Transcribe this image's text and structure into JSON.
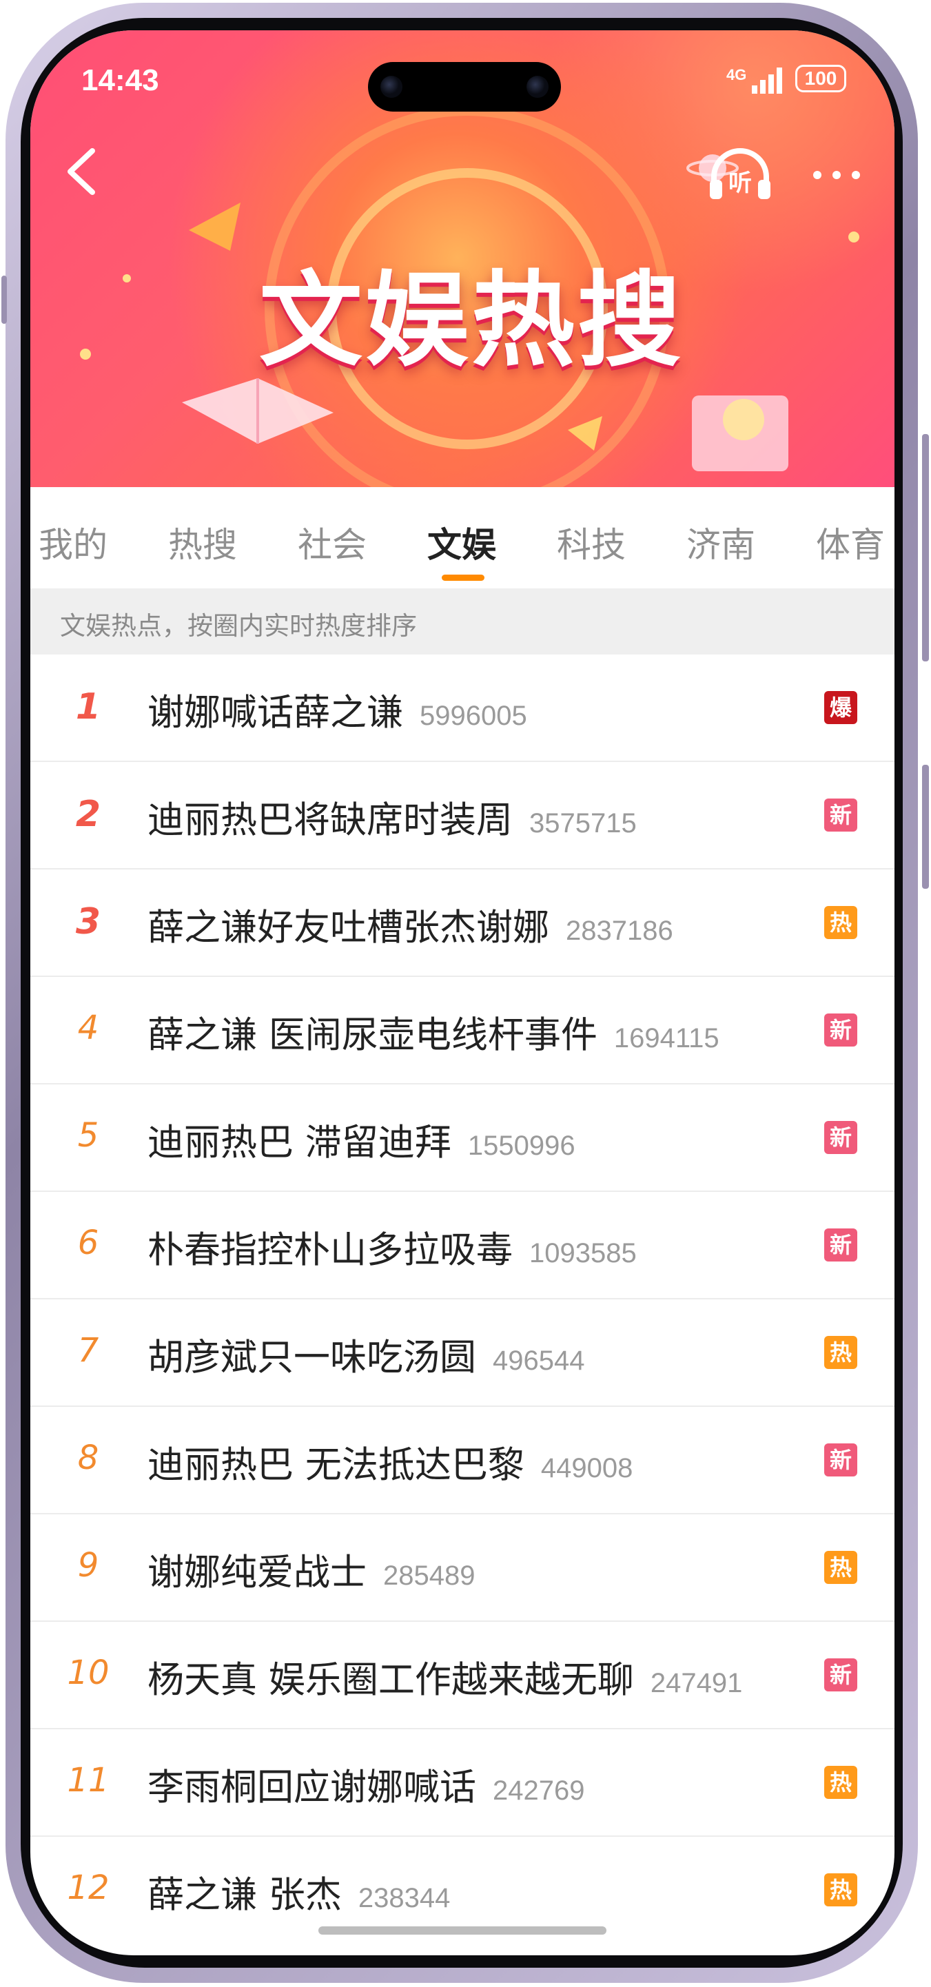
{
  "status_bar": {
    "time": "14:43",
    "network": "4G",
    "battery": "100"
  },
  "banner": {
    "title": "文娱热搜"
  },
  "tabs": [
    {
      "label": "我的",
      "active": false
    },
    {
      "label": "热搜",
      "active": false
    },
    {
      "label": "社会",
      "active": false
    },
    {
      "label": "文娱",
      "active": true
    },
    {
      "label": "科技",
      "active": false
    },
    {
      "label": "济南",
      "active": false
    },
    {
      "label": "体育",
      "active": false
    }
  ],
  "subheader": "文娱热点，按圈内实时热度排序",
  "colors": {
    "accent": "#ff8a00",
    "badge_bao": "#c8161d",
    "badge_xin": "#f05a7a",
    "badge_re": "#ff9a1a",
    "rank_top": "#f1584a",
    "rank_other": "#f28a2e"
  },
  "items": [
    {
      "rank": "1",
      "title": "谢娜喊话薛之谦",
      "count": "5996005",
      "badge": "爆"
    },
    {
      "rank": "2",
      "title": "迪丽热巴将缺席时装周",
      "count": "3575715",
      "badge": "新"
    },
    {
      "rank": "3",
      "title": "薛之谦好友吐槽张杰谢娜",
      "count": "2837186",
      "badge": "热"
    },
    {
      "rank": "4",
      "title": "薛之谦 医闹尿壶电线杆事件",
      "count": "1694115",
      "badge": "新"
    },
    {
      "rank": "5",
      "title": "迪丽热巴 滞留迪拜",
      "count": "1550996",
      "badge": "新"
    },
    {
      "rank": "6",
      "title": "朴春指控朴山多拉吸毒",
      "count": "1093585",
      "badge": "新"
    },
    {
      "rank": "7",
      "title": "胡彦斌只一味吃汤圆",
      "count": "496544",
      "badge": "热"
    },
    {
      "rank": "8",
      "title": "迪丽热巴 无法抵达巴黎",
      "count": "449008",
      "badge": "新"
    },
    {
      "rank": "9",
      "title": "谢娜纯爱战士",
      "count": "285489",
      "badge": "热"
    },
    {
      "rank": "10",
      "title": "杨天真 娱乐圈工作越来越无聊",
      "count": "247491",
      "badge": "新"
    },
    {
      "rank": "11",
      "title": "李雨桐回应谢娜喊话",
      "count": "242769",
      "badge": "热"
    },
    {
      "rank": "12",
      "title": "薛之谦 张杰",
      "count": "238344",
      "badge": "热"
    }
  ]
}
